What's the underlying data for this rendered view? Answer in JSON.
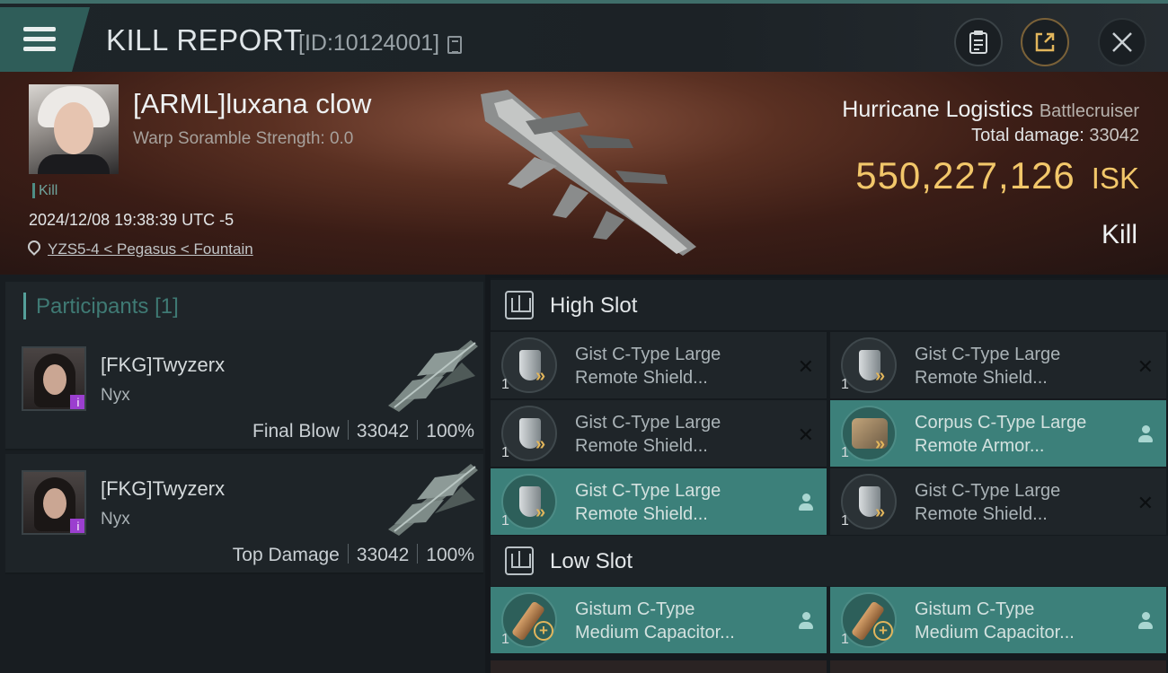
{
  "header": {
    "title": "KILL REPORT",
    "report_id": "[ID:10124001]",
    "icons": [
      "menu-icon",
      "copy-icon",
      "clipboard-icon",
      "share-icon",
      "close-icon"
    ]
  },
  "victim": {
    "name": "[ARML]luxana clow",
    "warp_scramble": "Warp Soramble Strength: 0.0",
    "tag": "Kill",
    "datetime": "2024/12/08 19:38:39 UTC -5",
    "location": "YZS5-4 < Pegasus < Fountain"
  },
  "ship": {
    "name": "Hurricane Logistics",
    "class": "Battlecruiser",
    "total_damage_label": "Total damage:",
    "total_damage": "33042",
    "isk_value": "550,227,126",
    "isk_unit": "ISK",
    "result": "Kill"
  },
  "participants": {
    "label": "Participants",
    "count": "[1]",
    "rows": [
      {
        "name": "[FKG]Twyzerx",
        "ship": "Nyx",
        "role": "Final Blow",
        "damage": "33042",
        "percent": "100%"
      },
      {
        "name": "[FKG]Twyzerx",
        "ship": "Nyx",
        "role": "Top Damage",
        "damage": "33042",
        "percent": "100%"
      }
    ]
  },
  "high_slot": {
    "label": "High Slot",
    "modules": [
      {
        "qty": "1",
        "line1": "Gist C-Type Large",
        "line2": "Remote Shield...",
        "icon": "shield-module-icon",
        "status": "destroyed"
      },
      {
        "qty": "1",
        "line1": "Gist C-Type Large",
        "line2": "Remote Shield...",
        "icon": "shield-module-icon",
        "status": "destroyed"
      },
      {
        "qty": "1",
        "line1": "Gist C-Type Large",
        "line2": "Remote Shield...",
        "icon": "shield-module-icon",
        "status": "destroyed"
      },
      {
        "qty": "1",
        "line1": "Corpus C-Type Large",
        "line2": "Remote Armor...",
        "icon": "armor-module-icon",
        "status": "dropped"
      },
      {
        "qty": "1",
        "line1": "Gist C-Type Large",
        "line2": "Remote Shield...",
        "icon": "shield-module-icon",
        "status": "dropped"
      },
      {
        "qty": "1",
        "line1": "Gist C-Type Large",
        "line2": "Remote Shield...",
        "icon": "shield-module-icon",
        "status": "destroyed"
      }
    ]
  },
  "low_slot": {
    "label": "Low Slot",
    "modules": [
      {
        "qty": "1",
        "line1": "Gistum C-Type",
        "line2": "Medium Capacitor...",
        "icon": "capacitor-module-icon",
        "status": "dropped"
      },
      {
        "qty": "1",
        "line1": "Gistum C-Type",
        "line2": "Medium Capacitor...",
        "icon": "capacitor-module-icon",
        "status": "dropped"
      }
    ]
  },
  "colors": {
    "accent_teal": "#3c807a",
    "isk_gold": "#f2c76a",
    "purple_badge": "#9b3fcf"
  }
}
